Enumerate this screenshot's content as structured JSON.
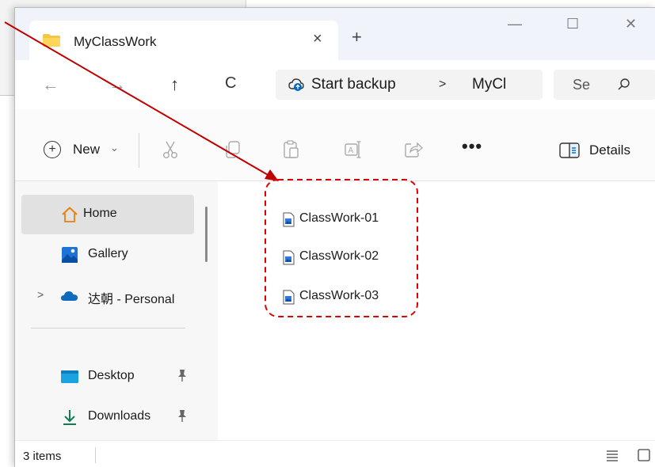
{
  "window": {
    "tab_title": "MyClassWork",
    "tab_close": "×",
    "new_tab": "+",
    "minimize": "—",
    "maximize": "☐",
    "close": "✕"
  },
  "address": {
    "back": "←",
    "forward": "→",
    "up": "↑",
    "refresh": "C",
    "backup_label": "Start backup",
    "separator": ">",
    "current": "MyCl",
    "search_placeholder": "Se"
  },
  "toolbar": {
    "new_label": "New",
    "new_chevron": "⌄",
    "more": "•••",
    "details_label": "Details",
    "icons": [
      "cut-icon",
      "copy-icon",
      "paste-icon",
      "rename-icon",
      "share-icon"
    ]
  },
  "sidebar": {
    "items": [
      {
        "label": "Home",
        "icon": "home-icon"
      },
      {
        "label": "Gallery",
        "icon": "gallery-icon"
      },
      {
        "label": "达朝 - Personal",
        "icon": "onedrive-icon"
      },
      {
        "label": "Desktop",
        "icon": "desktop-icon"
      },
      {
        "label": "Downloads",
        "icon": "download-icon"
      }
    ],
    "expand_chevron": ">"
  },
  "files": [
    {
      "name": "ClassWork-01"
    },
    {
      "name": "ClassWork-02"
    },
    {
      "name": "ClassWork-03"
    }
  ],
  "status": {
    "count": "3 items"
  },
  "colors": {
    "accent": "#0067c0",
    "annotation": "#c00000",
    "folder": "#f2c744"
  }
}
